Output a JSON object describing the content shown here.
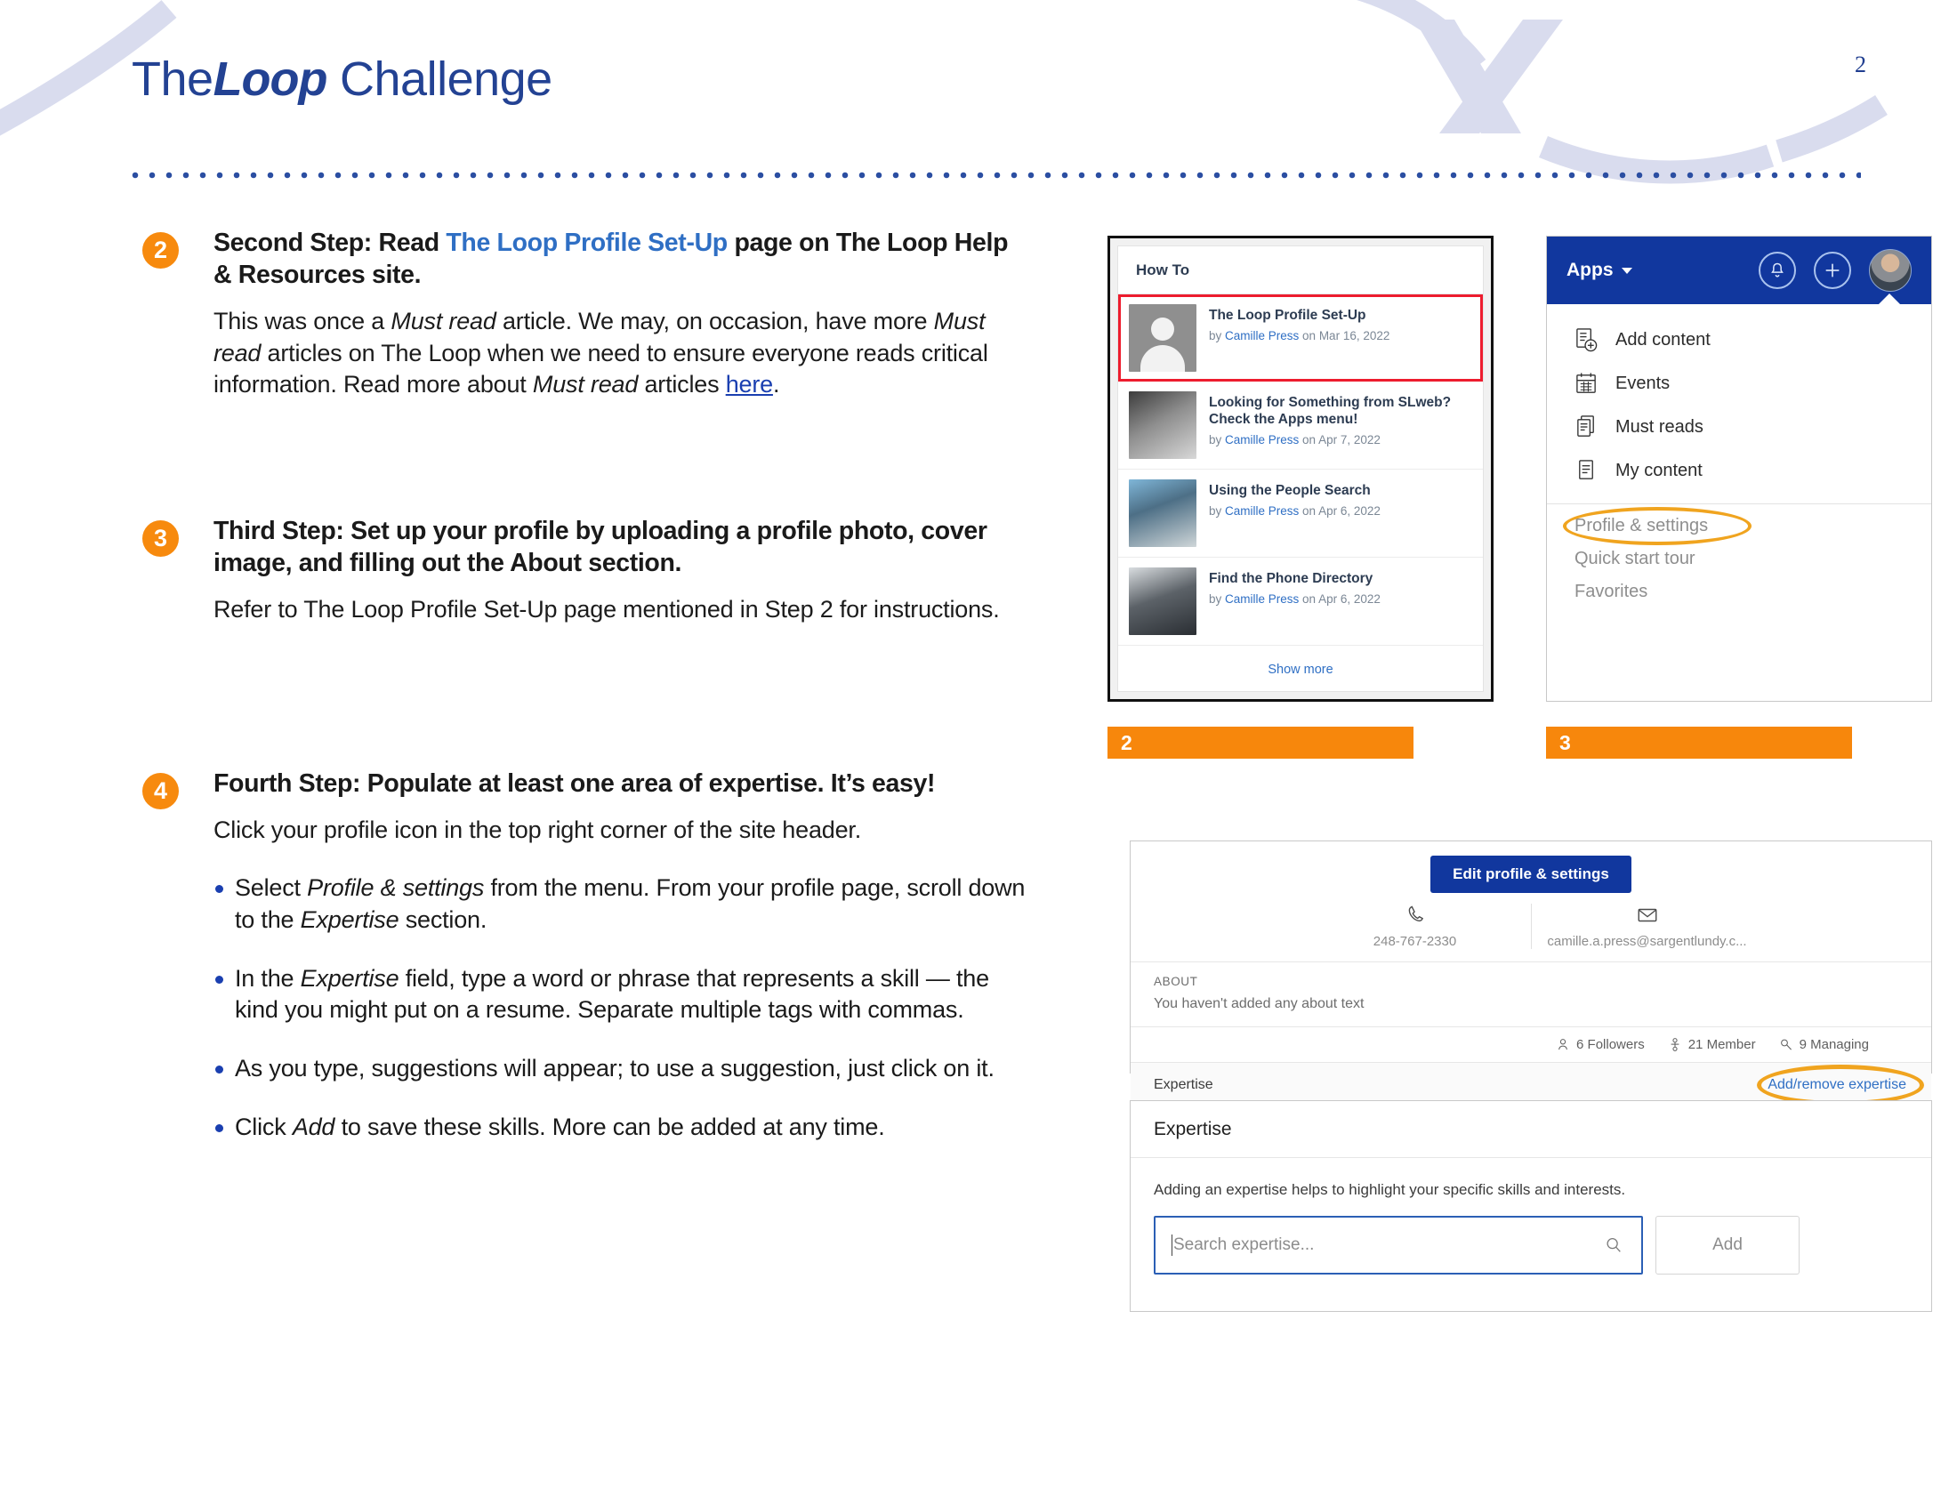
{
  "header": {
    "title_light_1": "The",
    "title_loop": "Loop",
    "title_light_2": " Challenge",
    "page_number": "2",
    "accent_blue": "#234293",
    "accent_orange": "#f7870c"
  },
  "steps": [
    {
      "number": "2",
      "heading_before": "Second Step: Read ",
      "heading_link": "The Loop Profile Set-Up",
      "heading_after": " page on The Loop Help & Resources site.",
      "paragraph_1": "This was once a ",
      "paragraph_em_1": "Must read",
      "paragraph_2": " article. We may, on occasion, have more ",
      "paragraph_em_2": "Must read",
      "paragraph_3": " articles on The Loop when we need to ensure everyone reads critical information. Read more about ",
      "paragraph_em_3": "Must read",
      "paragraph_4": " articles ",
      "paragraph_link": "here",
      "paragraph_5": "."
    },
    {
      "number": "3",
      "heading": "Third Step: Set up your profile by uploading a profile photo, cover image, and filling out the About section.",
      "paragraph": "Refer to The Loop Profile Set-Up page mentioned in Step 2 for instructions."
    },
    {
      "number": "4",
      "heading": "Fourth Step: Populate at least one area of expertise. It’s easy!",
      "paragraph": "Click your profile icon in the top right corner of the site header.",
      "bullets": [
        {
          "t1": "Select ",
          "em1": "Profile & settings",
          "t2": " from the menu. From your profile page, scroll down to the ",
          "em2": "Expertise",
          "t3": " section."
        },
        {
          "t1": "In the ",
          "em1": "Expertise",
          "t2": " field, type a word or phrase that represents a skill — the kind you might put on a resume. Separate multiple tags with commas.",
          "em2": "",
          "t3": ""
        },
        {
          "t1": "As you type, suggestions will appear; to use a suggestion, just click on it.",
          "em1": "",
          "t2": "",
          "em2": "",
          "t3": ""
        },
        {
          "t1": "Click ",
          "em1": "Add",
          "t2": " to save these skills. More can be added at any time.",
          "em2": "",
          "t3": ""
        }
      ]
    }
  ],
  "figures": {
    "howto": {
      "title": "How To",
      "items": [
        {
          "name": "The Loop Profile Set-Up",
          "by": "by ",
          "author": "Camille Press",
          "on": " on Mar 16, 2022",
          "thumb": "avatar-placeholder-image",
          "highlighted": true
        },
        {
          "name": "Looking for Something from SLweb? Check the Apps menu!",
          "by": "by ",
          "author": "Camille Press",
          "on": " on Apr 7, 2022",
          "thumb": "computer-mouse-image",
          "highlighted": false
        },
        {
          "name": "Using the People Search",
          "by": "by ",
          "author": "Camille Press",
          "on": " on Apr 6, 2022",
          "thumb": "people-meeting-image",
          "highlighted": false
        },
        {
          "name": "Find the Phone Directory",
          "by": "by ",
          "author": "Camille Press",
          "on": " on Apr 6, 2022",
          "thumb": "desk-phone-image",
          "highlighted": false
        }
      ],
      "show_more": "Show more"
    },
    "apps": {
      "apps_label": "Apps",
      "menu_items": [
        {
          "label": "Add content",
          "icon": "add-content-icon"
        },
        {
          "label": "Events",
          "icon": "calendar-icon"
        },
        {
          "label": "Must reads",
          "icon": "documents-icon"
        },
        {
          "label": "My content",
          "icon": "document-icon"
        }
      ],
      "secondary_items": [
        {
          "label": "Profile & settings",
          "highlighted": true
        },
        {
          "label": "Quick start tour",
          "highlighted": false
        },
        {
          "label": "Favorites",
          "highlighted": false
        }
      ]
    },
    "captions": [
      {
        "number": "2"
      },
      {
        "number": "3"
      }
    ],
    "profile": {
      "edit_button": "Edit profile & settings",
      "phone": "248-767-2330",
      "email": "camille.a.press@sargentlundy.c...",
      "about_label": "ABOUT",
      "about_text": "You haven't added any about text",
      "stats": [
        {
          "value": "6 Followers",
          "icon": "person-icon"
        },
        {
          "value": "21 Member",
          "icon": "group-icon"
        },
        {
          "value": "9 Managing",
          "icon": "key-icon"
        }
      ],
      "expertise_label": "Expertise",
      "expertise_link": "Add/remove expertise"
    },
    "expertise_dialog": {
      "title": "Expertise",
      "description": "Adding an expertise helps to highlight your specific skills and interests.",
      "search_placeholder": "Search expertise...",
      "search_value": "",
      "add_button": "Add"
    }
  }
}
